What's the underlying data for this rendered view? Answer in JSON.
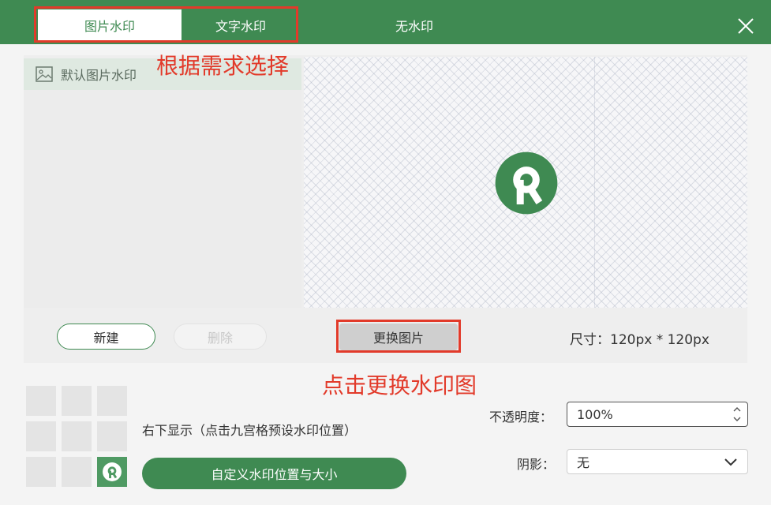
{
  "header": {
    "tabs": [
      {
        "label": "图片水印",
        "active": true
      },
      {
        "label": "文字水印",
        "active": false
      },
      {
        "label": "无水印",
        "active": false
      }
    ],
    "close_icon": "close-icon"
  },
  "annotations": {
    "choose": "根据需求选择",
    "change": "点击更换水印图"
  },
  "watermark_list": {
    "items": [
      {
        "icon": "image-icon",
        "label": "默认图片水印"
      }
    ]
  },
  "buttons": {
    "new": "新建",
    "delete": "删除",
    "change_image": "更换图片",
    "custom_position": "自定义水印位置与大小"
  },
  "size": "尺寸：120px * 120px",
  "position": {
    "text": "右下显示（点击九宫格预设水印位置）",
    "selected_cell": 8
  },
  "opacity": {
    "label": "不透明度：",
    "value": "100%"
  },
  "shadow": {
    "label": "阴影：",
    "value": "无"
  },
  "colors": {
    "brand": "#3f8a52",
    "annotation": "#e23a2a"
  }
}
